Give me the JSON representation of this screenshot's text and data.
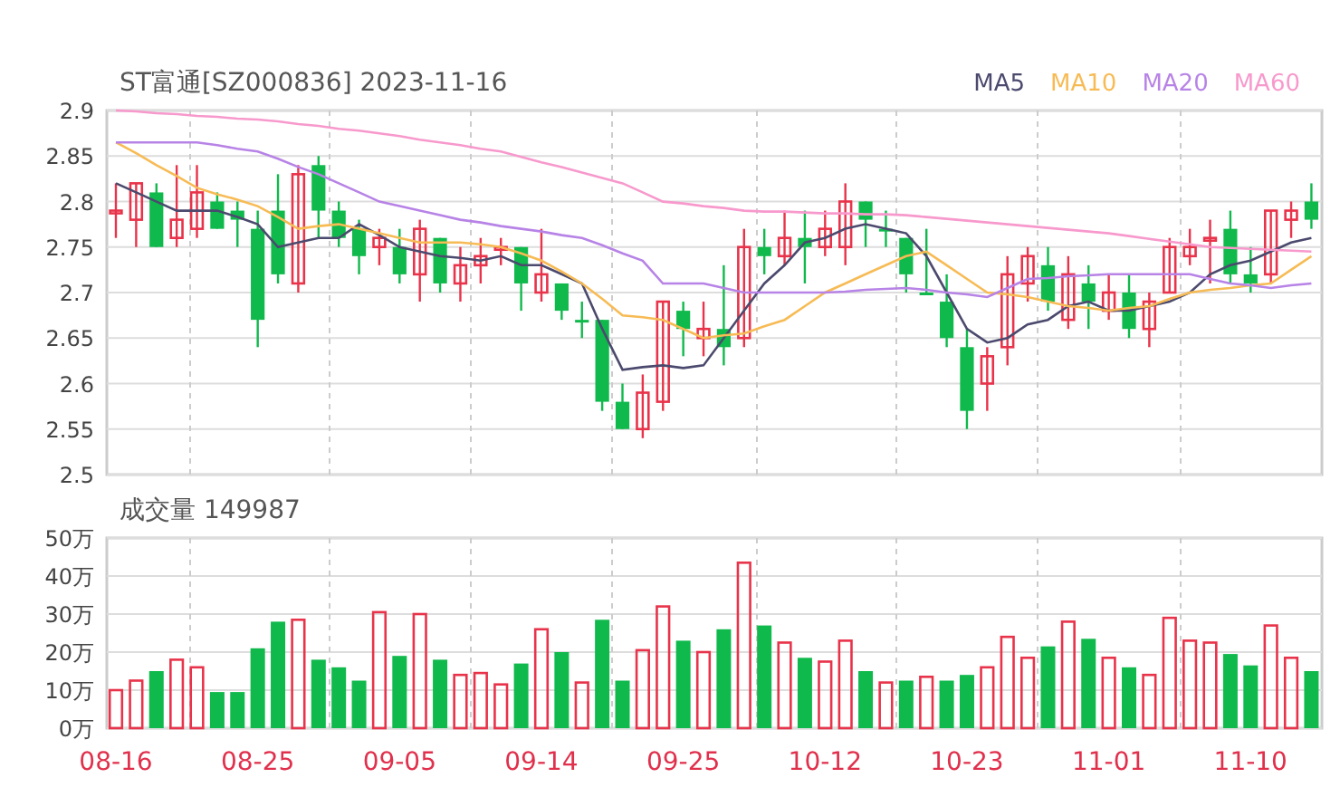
{
  "header": {
    "title": "ST富通[SZ000836] 2023-11-16"
  },
  "price_chart": {
    "chart_data": {
      "type": "candlestick",
      "grid": true,
      "ylim": [
        2.5,
        2.9
      ],
      "yticks": [
        2.9,
        2.85,
        2.8,
        2.75,
        2.7,
        2.65,
        2.6,
        2.55,
        2.5
      ],
      "categories": [
        null,
        null,
        null,
        null,
        null,
        null,
        null,
        null,
        null,
        null,
        null,
        null,
        null,
        null,
        null,
        null,
        null,
        null,
        null,
        null,
        null,
        null,
        null,
        null,
        null,
        null,
        null,
        null,
        null,
        null,
        null,
        null,
        null,
        null,
        null,
        null,
        null,
        null,
        null,
        null,
        null,
        null,
        null,
        null,
        null,
        null,
        null,
        null,
        null,
        null,
        null,
        null,
        null,
        null,
        null,
        null,
        null,
        null,
        null,
        null
      ],
      "ohlc": [
        [
          2.79,
          2.82,
          2.76,
          2.79
        ],
        [
          2.78,
          2.82,
          2.75,
          2.82
        ],
        [
          2.81,
          2.82,
          2.75,
          2.75
        ],
        [
          2.76,
          2.84,
          2.75,
          2.78
        ],
        [
          2.77,
          2.84,
          2.76,
          2.81
        ],
        [
          2.8,
          2.81,
          2.77,
          2.77
        ],
        [
          2.79,
          2.8,
          2.75,
          2.78
        ],
        [
          2.77,
          2.79,
          2.64,
          2.67
        ],
        [
          2.79,
          2.83,
          2.71,
          2.72
        ],
        [
          2.71,
          2.84,
          2.7,
          2.83
        ],
        [
          2.84,
          2.85,
          2.76,
          2.79
        ],
        [
          2.79,
          2.8,
          2.75,
          2.76
        ],
        [
          2.77,
          2.78,
          2.72,
          2.74
        ],
        [
          2.75,
          2.77,
          2.73,
          2.76
        ],
        [
          2.75,
          2.77,
          2.71,
          2.72
        ],
        [
          2.72,
          2.78,
          2.69,
          2.77
        ],
        [
          2.76,
          2.76,
          2.7,
          2.71
        ],
        [
          2.71,
          2.75,
          2.69,
          2.73
        ],
        [
          2.73,
          2.76,
          2.71,
          2.74
        ],
        [
          2.75,
          2.76,
          2.73,
          2.75
        ],
        [
          2.75,
          2.75,
          2.68,
          2.71
        ],
        [
          2.7,
          2.77,
          2.69,
          2.72
        ],
        [
          2.71,
          2.71,
          2.67,
          2.68
        ],
        [
          2.67,
          2.69,
          2.65,
          2.67
        ],
        [
          2.67,
          2.67,
          2.57,
          2.58
        ],
        [
          2.58,
          2.6,
          2.55,
          2.55
        ],
        [
          2.55,
          2.61,
          2.54,
          2.59
        ],
        [
          2.58,
          2.69,
          2.57,
          2.69
        ],
        [
          2.68,
          2.69,
          2.63,
          2.66
        ],
        [
          2.65,
          2.69,
          2.63,
          2.66
        ],
        [
          2.66,
          2.73,
          2.62,
          2.64
        ],
        [
          2.65,
          2.77,
          2.64,
          2.75
        ],
        [
          2.75,
          2.77,
          2.72,
          2.74
        ],
        [
          2.74,
          2.79,
          2.73,
          2.76
        ],
        [
          2.76,
          2.79,
          2.71,
          2.75
        ],
        [
          2.75,
          2.79,
          2.74,
          2.77
        ],
        [
          2.75,
          2.82,
          2.73,
          2.8
        ],
        [
          2.8,
          2.8,
          2.75,
          2.78
        ],
        [
          2.77,
          2.79,
          2.75,
          2.77
        ],
        [
          2.76,
          2.76,
          2.7,
          2.72
        ],
        [
          2.7,
          2.77,
          2.7,
          2.7
        ],
        [
          2.69,
          2.72,
          2.64,
          2.65
        ],
        [
          2.64,
          2.66,
          2.55,
          2.57
        ],
        [
          2.6,
          2.64,
          2.57,
          2.63
        ],
        [
          2.64,
          2.74,
          2.62,
          2.72
        ],
        [
          2.71,
          2.75,
          2.69,
          2.74
        ],
        [
          2.73,
          2.75,
          2.68,
          2.69
        ],
        [
          2.67,
          2.74,
          2.66,
          2.72
        ],
        [
          2.71,
          2.73,
          2.66,
          2.69
        ],
        [
          2.68,
          2.72,
          2.67,
          2.7
        ],
        [
          2.7,
          2.72,
          2.65,
          2.66
        ],
        [
          2.66,
          2.7,
          2.64,
          2.69
        ],
        [
          2.7,
          2.76,
          2.7,
          2.75
        ],
        [
          2.74,
          2.77,
          2.73,
          2.75
        ],
        [
          2.76,
          2.78,
          2.71,
          2.76
        ],
        [
          2.77,
          2.79,
          2.71,
          2.72
        ],
        [
          2.72,
          2.75,
          2.7,
          2.71
        ],
        [
          2.72,
          2.79,
          2.71,
          2.79
        ],
        [
          2.78,
          2.8,
          2.76,
          2.79
        ],
        [
          2.8,
          2.82,
          2.77,
          2.78
        ]
      ]
    }
  },
  "ma_chart": {
    "chart_data": {
      "type": "line",
      "ylim": [
        2.5,
        2.9
      ],
      "series": [
        {
          "name": "MA5",
          "color": "#4b4a6e",
          "values": [
            2.82,
            2.81,
            2.8,
            2.79,
            2.79,
            2.79,
            2.783,
            2.775,
            2.75,
            2.755,
            2.76,
            2.76,
            2.775,
            2.763,
            2.75,
            2.745,
            2.74,
            2.738,
            2.735,
            2.74,
            2.73,
            2.73,
            2.72,
            2.71,
            2.66,
            2.615,
            2.618,
            2.62,
            2.617,
            2.62,
            2.65,
            2.68,
            2.71,
            2.73,
            2.755,
            2.76,
            2.77,
            2.775,
            2.77,
            2.765,
            2.74,
            2.7,
            2.66,
            2.645,
            2.65,
            2.665,
            2.67,
            2.685,
            2.69,
            2.68,
            2.68,
            2.685,
            2.69,
            2.7,
            2.72,
            2.73,
            2.735,
            2.745,
            2.755,
            2.76
          ]
        },
        {
          "name": "MA10",
          "color": "#f7bb55",
          "values": [
            2.865,
            2.853,
            2.84,
            2.828,
            2.815,
            2.808,
            2.802,
            2.795,
            2.783,
            2.77,
            2.773,
            2.775,
            2.77,
            2.765,
            2.76,
            2.755,
            2.755,
            2.755,
            2.753,
            2.75,
            2.743,
            2.735,
            2.723,
            2.71,
            2.693,
            2.675,
            2.673,
            2.67,
            2.66,
            2.65,
            2.653,
            2.655,
            2.663,
            2.67,
            2.685,
            2.7,
            2.71,
            2.72,
            2.73,
            2.74,
            2.745,
            2.73,
            2.715,
            2.7,
            2.698,
            2.695,
            2.69,
            2.685,
            2.683,
            2.68,
            2.683,
            2.685,
            2.693,
            2.7,
            2.703,
            2.705,
            2.708,
            2.71,
            2.725,
            2.74
          ]
        },
        {
          "name": "MA20",
          "color": "#b783e6",
          "values": [
            2.865,
            2.865,
            2.865,
            2.865,
            2.865,
            2.862,
            2.858,
            2.855,
            2.847,
            2.838,
            2.83,
            2.82,
            2.81,
            2.8,
            2.795,
            2.79,
            2.785,
            2.78,
            2.777,
            2.773,
            2.77,
            2.767,
            2.763,
            2.76,
            2.752,
            2.743,
            2.735,
            2.71,
            2.71,
            2.71,
            2.705,
            2.7,
            2.7,
            2.7,
            2.7,
            2.7,
            2.701,
            2.703,
            2.704,
            2.705,
            2.703,
            2.7,
            2.698,
            2.695,
            2.705,
            2.715,
            2.716,
            2.718,
            2.719,
            2.72,
            2.72,
            2.72,
            2.72,
            2.72,
            2.715,
            2.71,
            2.708,
            2.705,
            2.708,
            2.71
          ]
        },
        {
          "name": "MA60",
          "color": "#f799cc",
          "values": [
            2.9,
            2.899,
            2.897,
            2.896,
            2.894,
            2.893,
            2.891,
            2.89,
            2.888,
            2.885,
            2.883,
            2.88,
            2.878,
            2.875,
            2.872,
            2.868,
            2.865,
            2.862,
            2.858,
            2.855,
            2.849,
            2.843,
            2.838,
            2.832,
            2.826,
            2.82,
            2.81,
            2.8,
            2.798,
            2.795,
            2.793,
            2.79,
            2.789,
            2.789,
            2.788,
            2.787,
            2.787,
            2.786,
            2.786,
            2.785,
            2.783,
            2.781,
            2.779,
            2.777,
            2.775,
            2.773,
            2.771,
            2.769,
            2.767,
            2.765,
            2.762,
            2.759,
            2.756,
            2.753,
            2.75,
            2.749,
            2.748,
            2.747,
            2.746,
            2.745
          ]
        }
      ]
    }
  },
  "volume_chart": {
    "chart_data": {
      "type": "bar",
      "title": "成交量 149987",
      "stacked": true,
      "grid": true,
      "yticks": [
        {
          "value": 0,
          "label": "0万"
        },
        {
          "value": 10,
          "label": "10万"
        },
        {
          "value": 20,
          "label": "20万"
        },
        {
          "value": 30,
          "label": "30万"
        },
        {
          "value": 40,
          "label": "40万"
        },
        {
          "value": 50,
          "label": "50万"
        }
      ],
      "ylim": [
        0,
        50
      ],
      "categories": [
        "08-16",
        null,
        null,
        null,
        null,
        null,
        null,
        "08-25",
        null,
        null,
        null,
        null,
        null,
        null,
        "09-05",
        null,
        null,
        null,
        null,
        null,
        null,
        "09-14",
        null,
        null,
        null,
        null,
        null,
        null,
        "09-25",
        null,
        null,
        null,
        null,
        null,
        null,
        "10-12",
        null,
        null,
        null,
        null,
        null,
        null,
        "10-23",
        null,
        null,
        null,
        null,
        null,
        null,
        "11-01",
        null,
        null,
        null,
        null,
        null,
        null,
        "11-10",
        null,
        null,
        null
      ],
      "series": [
        {
          "color": "#e8334a",
          "values": [
            10,
            12.5,
            null,
            18,
            16,
            null,
            null,
            null,
            null,
            28.5,
            null,
            null,
            null,
            30.5,
            null,
            30,
            null,
            14,
            14.5,
            11.5,
            null,
            26,
            null,
            12,
            null,
            null,
            20.5,
            32,
            null,
            20,
            null,
            43.5,
            null,
            22.5,
            null,
            17.5,
            23,
            null,
            12,
            null,
            13.5,
            null,
            null,
            16,
            24,
            18.5,
            null,
            28,
            null,
            18.5,
            null,
            14,
            29,
            23,
            22.5,
            null,
            null,
            27,
            18.5,
            null
          ]
        },
        {
          "color": "#10b94c",
          "values": [
            null,
            null,
            15,
            null,
            null,
            9.5,
            9.5,
            21,
            28,
            null,
            18,
            16,
            12.5,
            null,
            19,
            null,
            18,
            null,
            null,
            null,
            17,
            null,
            20,
            null,
            28.5,
            12.5,
            null,
            null,
            23,
            null,
            26,
            null,
            27,
            null,
            18.5,
            null,
            null,
            15,
            null,
            12.5,
            null,
            12.5,
            14,
            null,
            null,
            null,
            21.5,
            null,
            23.5,
            null,
            16,
            null,
            null,
            null,
            null,
            19.5,
            16.5,
            null,
            null,
            15
          ]
        }
      ]
    }
  }
}
